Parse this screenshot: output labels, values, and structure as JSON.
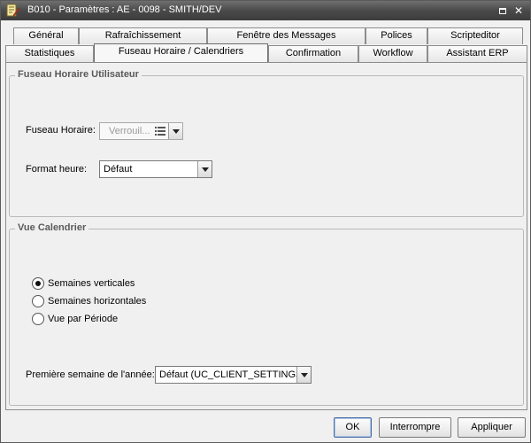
{
  "window": {
    "title": "B010 - Paramètres : AE - 0098 - SMITH/DEV",
    "maximize_icon": "maximize-icon",
    "close_icon": "close-icon",
    "close_glyph": "✕"
  },
  "tabs": {
    "row_back": [
      {
        "label": "Général"
      },
      {
        "label": "Rafraîchissement"
      },
      {
        "label": "Fenêtre des Messages"
      },
      {
        "label": "Polices"
      },
      {
        "label": "Scripteditor"
      }
    ],
    "row_front": [
      {
        "label": "Statistiques"
      },
      {
        "label": "Fuseau Horaire / Calendriers",
        "active": true
      },
      {
        "label": "Confirmation"
      },
      {
        "label": "Workflow"
      },
      {
        "label": "Assistant ERP"
      }
    ]
  },
  "timezone_group": {
    "title": "Fuseau Horaire Utilisateur",
    "timezone_label": "Fuseau Horaire:",
    "timezone_value": "Verrouil...",
    "format_label": "Format heure:",
    "format_value": "Défaut"
  },
  "calendar_group": {
    "title": "Vue Calendrier",
    "options": [
      {
        "label": "Semaines verticales",
        "checked": true
      },
      {
        "label": "Semaines horizontales",
        "checked": false
      },
      {
        "label": "Vue par Période",
        "checked": false
      }
    ],
    "first_week_label": "Première semaine de l'année:",
    "first_week_value": "Défaut (UC_CLIENT_SETTINGS)"
  },
  "buttons": {
    "ok": "OK",
    "cancel": "Interrompre",
    "apply": "Appliquer"
  },
  "colors": {
    "titlebar": "#4a4a4a",
    "panel_bg": "#f0f0f0",
    "group_title": "#5a5a5a"
  }
}
